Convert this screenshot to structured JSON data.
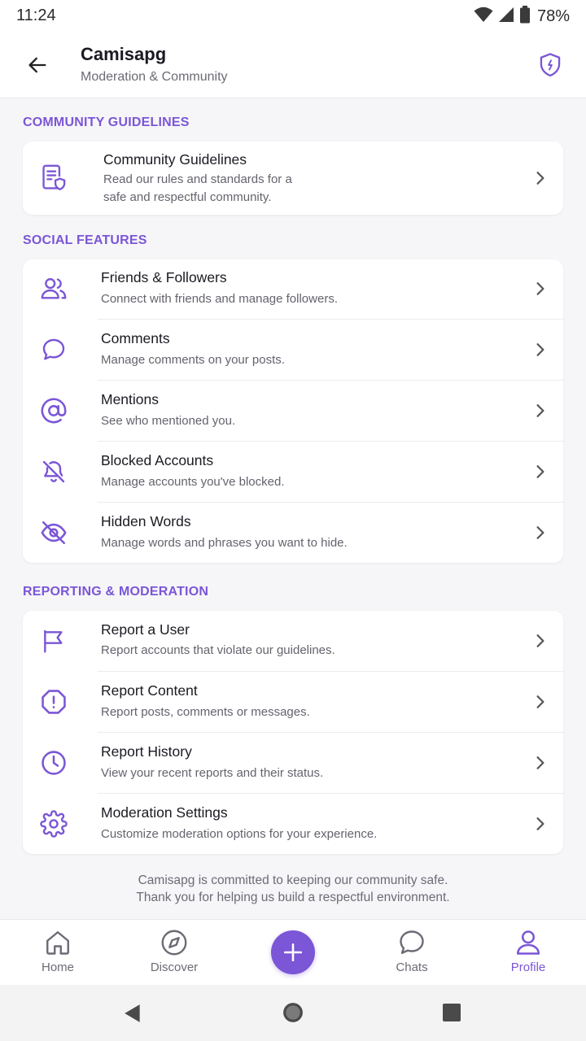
{
  "status_bar": {
    "time": "11:24",
    "battery": "78%"
  },
  "header": {
    "title": "Camisapg",
    "subtitle": "Moderation & Community"
  },
  "sections": [
    {
      "label": "COMMUNITY GUIDELINES",
      "items": [
        {
          "icon": "document-shield-icon",
          "title": "Community Guidelines",
          "subtitle": "Read our rules and standards for a\nsafe and respectful community."
        }
      ]
    },
    {
      "label": "SOCIAL FEATURES",
      "items": [
        {
          "icon": "users-icon",
          "title": "Friends & Followers",
          "subtitle": "Connect with friends and manage followers."
        },
        {
          "icon": "comment-icon",
          "title": "Comments",
          "subtitle": "Manage comments on your posts."
        },
        {
          "icon": "at-sign-icon",
          "title": "Mentions",
          "subtitle": "See who mentioned you."
        },
        {
          "icon": "bell-off-icon",
          "title": "Blocked Accounts",
          "subtitle": "Manage accounts you've blocked."
        },
        {
          "icon": "eye-off-icon",
          "title": "Hidden Words",
          "subtitle": "Manage words and phrases you want to hide."
        }
      ]
    },
    {
      "label": "REPORTING & MODERATION",
      "items": [
        {
          "icon": "flag-icon",
          "title": "Report a User",
          "subtitle": "Report accounts that violate our guidelines."
        },
        {
          "icon": "alert-octagon-icon",
          "title": "Report Content",
          "subtitle": "Report posts, comments or messages."
        },
        {
          "icon": "clock-icon",
          "title": "Report History",
          "subtitle": "View your recent reports and their status."
        },
        {
          "icon": "gear-icon",
          "title": "Moderation Settings",
          "subtitle": "Customize moderation options for your experience."
        }
      ]
    }
  ],
  "footer_note": {
    "line1": "Camisapg is committed to keeping our community safe.",
    "line2": "Thank you for helping us build a respectful environment."
  },
  "bottom_nav": {
    "home": "Home",
    "discover": "Discover",
    "chats": "Chats",
    "profile": "Profile",
    "active": "profile"
  },
  "colors": {
    "accent": "#7b56d6",
    "text": "#1a1a22",
    "muted": "#63636d",
    "background": "#f6f6f9"
  }
}
